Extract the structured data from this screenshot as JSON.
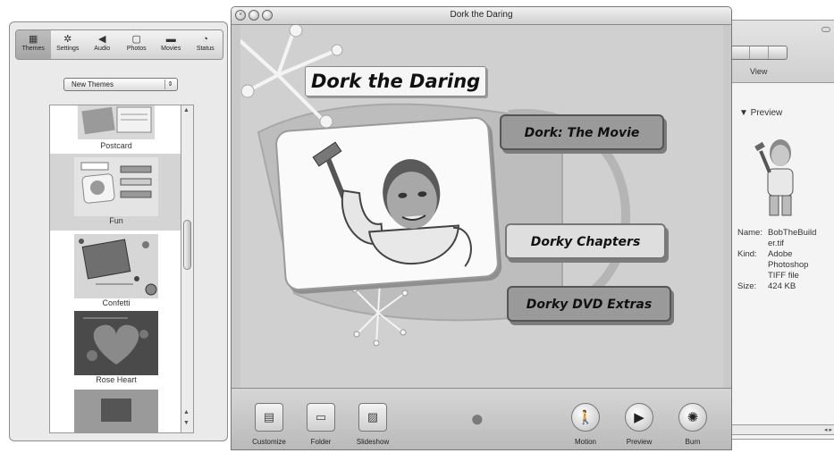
{
  "main_window": {
    "title": "Dork the Daring"
  },
  "drawer": {
    "tabs": [
      {
        "label": "Themes",
        "icon": "themes-icon",
        "glyph": "▦"
      },
      {
        "label": "Settings",
        "icon": "gear-icon",
        "glyph": "✲"
      },
      {
        "label": "Audio",
        "icon": "speaker-icon",
        "glyph": "◀"
      },
      {
        "label": "Photos",
        "icon": "photo-icon",
        "glyph": "▢"
      },
      {
        "label": "Movies",
        "icon": "movie-icon",
        "glyph": "▬"
      },
      {
        "label": "Status",
        "icon": "status-icon",
        "glyph": "◔"
      }
    ],
    "theme_popup": "New Themes",
    "themes": [
      {
        "name": "Postcard"
      },
      {
        "name": "Fun"
      },
      {
        "name": "Confetti"
      },
      {
        "name": "Rose Heart"
      }
    ]
  },
  "menu": {
    "title": "Dork the Daring",
    "buttons": [
      "Dork: The Movie",
      "Dorky Chapters",
      "Dorky DVD Extras"
    ]
  },
  "toolbar": {
    "left": [
      {
        "label": "Customize",
        "icon": "customize-icon",
        "glyph": "▤"
      },
      {
        "label": "Folder",
        "icon": "folder-icon",
        "glyph": "▭"
      },
      {
        "label": "Slideshow",
        "icon": "slideshow-icon",
        "glyph": "▨"
      }
    ],
    "right": [
      {
        "label": "Motion",
        "icon": "motion-icon",
        "glyph": "🚶"
      },
      {
        "label": "Preview",
        "icon": "play-icon",
        "glyph": "▶"
      },
      {
        "label": "Burn",
        "icon": "burn-icon",
        "glyph": "✺"
      }
    ]
  },
  "finder": {
    "view_label": "View",
    "preview_label": "▼ Preview",
    "info": [
      {
        "key": "Name:",
        "value": "BobTheBuilder.tif"
      },
      {
        "key": "Kind:",
        "value": "Adobe Photoshop TIFF file"
      },
      {
        "key": "Size:",
        "value": "424 KB"
      }
    ]
  }
}
